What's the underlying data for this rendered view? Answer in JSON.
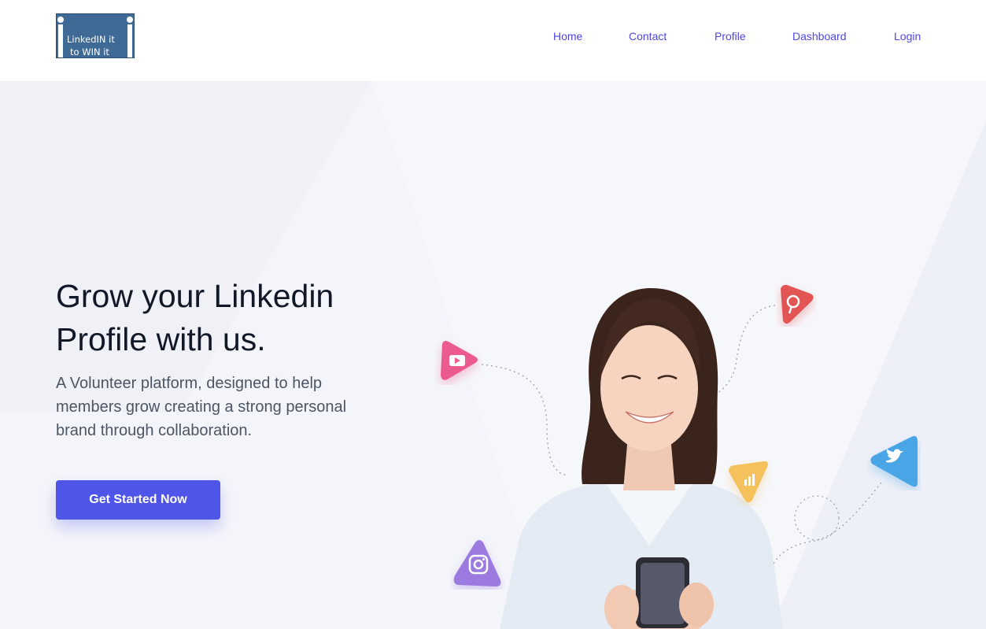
{
  "logo": {
    "line1": "LinkedIN it",
    "line2": "to WIN it"
  },
  "nav": {
    "items": [
      {
        "label": "Home"
      },
      {
        "label": "Contact"
      },
      {
        "label": "Profile"
      },
      {
        "label": "Dashboard"
      },
      {
        "label": "Login"
      }
    ]
  },
  "hero": {
    "title": "Grow your Linkedin Profile with us.",
    "subtitle": "A Volunteer platform, designed to help members grow creating a strong personal brand through collaboration.",
    "cta_label": "Get Started Now"
  },
  "social_badges": [
    {
      "icon": "youtube-icon",
      "color": "#ec5b8d"
    },
    {
      "icon": "pinterest-icon",
      "color": "#e35555"
    },
    {
      "icon": "analytics-icon",
      "color": "#f5c15d"
    },
    {
      "icon": "twitter-icon",
      "color": "#4aa5e6"
    },
    {
      "icon": "instagram-icon",
      "color": "#9b7be0"
    }
  ],
  "colors": {
    "accent": "#4f46e5",
    "button": "#4f55e8",
    "hero_bg": "#f4f5fa",
    "title": "#111827",
    "body_text": "#4b5563"
  }
}
